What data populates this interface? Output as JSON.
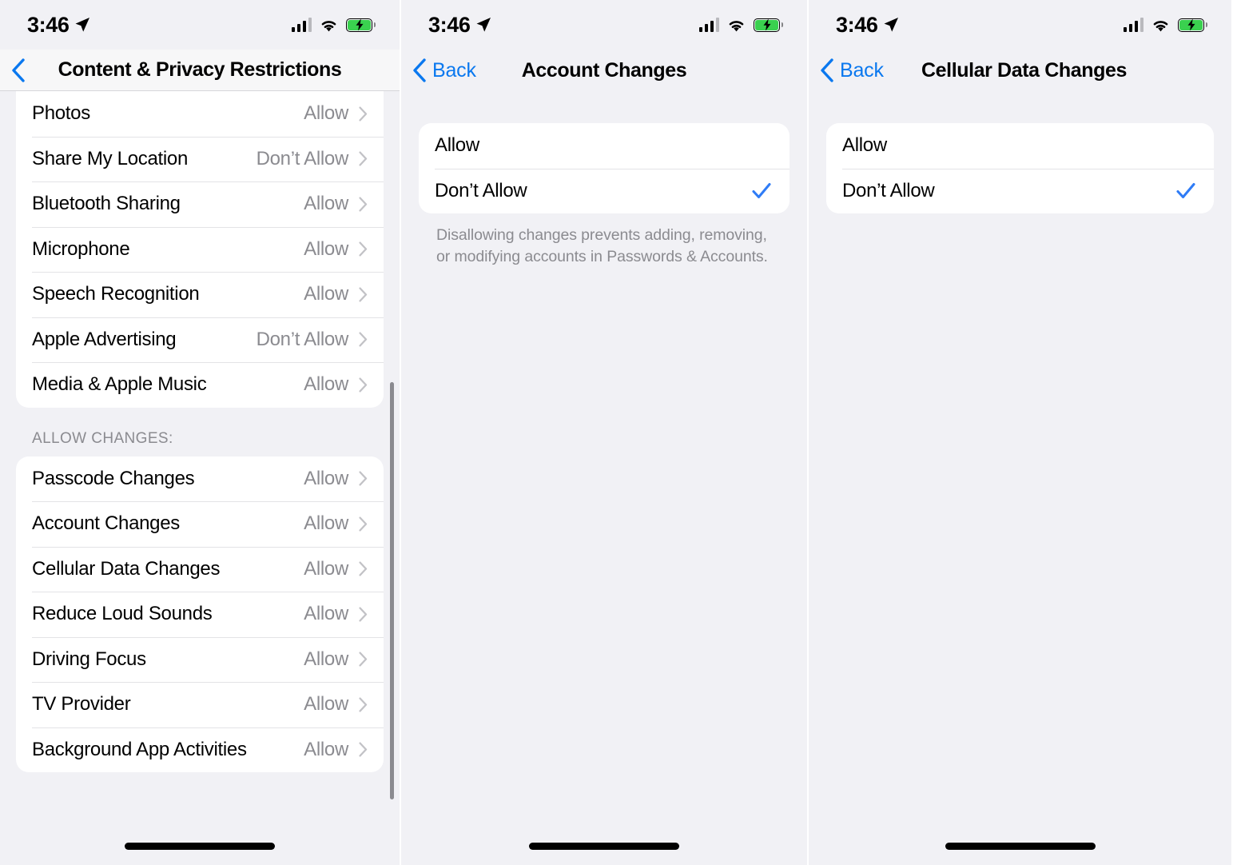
{
  "status_bar": {
    "time": "3:46",
    "location_icon": "location-arrow-icon",
    "signal_icon": "cellular-signal-icon",
    "wifi_icon": "wifi-icon",
    "battery_icon": "battery-charging-icon",
    "battery_color": "#3ad14f"
  },
  "colors": {
    "accent_blue": "#0a78ef",
    "checkmark_blue": "#2f7cf6",
    "value_gray": "#8b8b90",
    "page_background": "#f1f1f5",
    "card_background": "#ffffff"
  },
  "panel1": {
    "nav": {
      "back_label": "",
      "back_icon": "chevron-left-icon",
      "title": "Content & Privacy Restrictions"
    },
    "group1": [
      {
        "label": "Photos",
        "value": "Allow"
      },
      {
        "label": "Share My Location",
        "value": "Don’t Allow"
      },
      {
        "label": "Bluetooth Sharing",
        "value": "Allow"
      },
      {
        "label": "Microphone",
        "value": "Allow"
      },
      {
        "label": "Speech Recognition",
        "value": "Allow"
      },
      {
        "label": "Apple Advertising",
        "value": "Don’t Allow"
      },
      {
        "label": "Media & Apple Music",
        "value": "Allow"
      }
    ],
    "section_header": "ALLOW CHANGES:",
    "group2": [
      {
        "label": "Passcode Changes",
        "value": "Allow"
      },
      {
        "label": "Account Changes",
        "value": "Allow"
      },
      {
        "label": "Cellular Data Changes",
        "value": "Allow"
      },
      {
        "label": "Reduce Loud Sounds",
        "value": "Allow"
      },
      {
        "label": "Driving Focus",
        "value": "Allow"
      },
      {
        "label": "TV Provider",
        "value": "Allow"
      },
      {
        "label": "Background App Activities",
        "value": "Allow"
      }
    ]
  },
  "panel2": {
    "nav": {
      "back_label": "Back",
      "back_icon": "chevron-left-icon",
      "title": "Account Changes"
    },
    "options": [
      {
        "label": "Allow",
        "selected": false
      },
      {
        "label": "Don’t Allow",
        "selected": true
      }
    ],
    "footnote": "Disallowing changes prevents adding, removing, or modifying accounts in Passwords & Accounts."
  },
  "panel3": {
    "nav": {
      "back_label": "Back",
      "back_icon": "chevron-left-icon",
      "title": "Cellular Data Changes"
    },
    "options": [
      {
        "label": "Allow",
        "selected": false
      },
      {
        "label": "Don’t Allow",
        "selected": true
      }
    ],
    "footnote": ""
  }
}
